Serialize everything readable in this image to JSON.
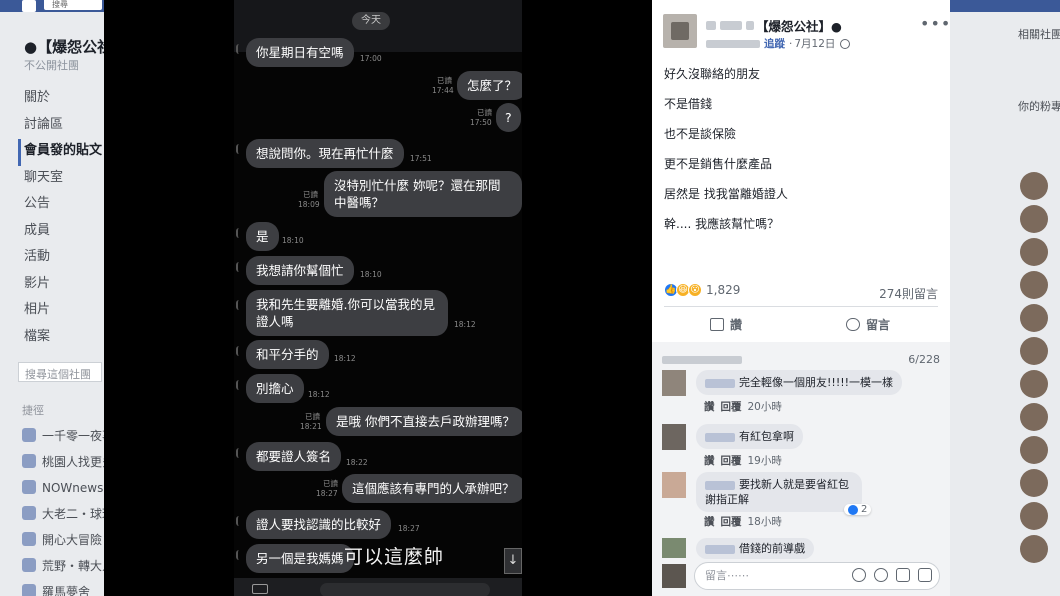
{
  "facebook": {
    "search_placeholder": "搜尋",
    "group_title": "●【爆怨公社】",
    "group_sub": "不公開社團",
    "nav": [
      "關於",
      "討論區",
      "會員發的貼文",
      "聊天室",
      "公告",
      "成員",
      "活動",
      "影片",
      "相片",
      "檔案"
    ],
    "search_group_placeholder": "搜尋這個社團",
    "shortcuts_label": "捷徑",
    "shortcuts": [
      "一千零一夜事",
      "桃園人找更多",
      "NOWnews・",
      "大老二・球球",
      "開心大冒險",
      "荒野・轉大人",
      "羅馬夢舍"
    ],
    "right_labels": [
      "相關社團",
      "你的粉專"
    ]
  },
  "chat": {
    "today": "今天",
    "subtitle": "可以這麼帥",
    "scroll_down_glyph": "↓",
    "messages": [
      {
        "dir": "in",
        "text": "你星期日有空嗎",
        "time": "17:00"
      },
      {
        "dir": "out",
        "text": "怎麼了？",
        "read": "已讀",
        "time": "17:44"
      },
      {
        "dir": "out",
        "text": "?",
        "read": "已讀",
        "time": "17:50"
      },
      {
        "dir": "in",
        "text": "想說問你。現在再忙什麼",
        "time": "17:51"
      },
      {
        "dir": "out",
        "text": "沒特別忙什麼 妳呢？還在那間中醫嗎？",
        "read": "已讀",
        "time": "18:09"
      },
      {
        "dir": "in",
        "text": "是",
        "time": "18:10"
      },
      {
        "dir": "in",
        "text": "我想請你幫個忙",
        "time": "18:10"
      },
      {
        "dir": "in",
        "text": "我和先生要離婚.你可以當我的見證人嗎",
        "time": "18:12"
      },
      {
        "dir": "in",
        "text": "和平分手的",
        "time": "18:12"
      },
      {
        "dir": "in",
        "text": "別擔心",
        "time": "18:12"
      },
      {
        "dir": "out",
        "text": "是哦 你們不直接去戶政辦理嗎？",
        "read": "已讀",
        "time": "18:21"
      },
      {
        "dir": "in",
        "text": "都要證人簽名",
        "time": "18:22"
      },
      {
        "dir": "out",
        "text": "這個應該有專門的人承辦吧？",
        "read": "已讀",
        "time": "18:27"
      },
      {
        "dir": "in",
        "text": "證人要找認識的比較好",
        "time": "18:27"
      },
      {
        "dir": "in",
        "text": "另一個是我媽媽",
        "time": ""
      }
    ]
  },
  "post": {
    "group_name": "【爆怨公社】●",
    "follow_label": "追蹤",
    "date": "7月12日",
    "more_glyph": "•••",
    "body_lines": [
      "好久沒聯絡的朋友",
      "不是借錢",
      "也不是談保險",
      "更不是銷售什麼產品",
      "居然是 找我當離婚證人",
      "幹.... 我應該幫忙嗎？"
    ],
    "reaction_count": "1,829",
    "comment_count": "274則留言",
    "like_label": "讚",
    "comment_label": "留言",
    "comments_page": "6/228",
    "comments": [
      {
        "text": "完全輕像一個朋友!!!!!一模一樣",
        "actions": [
          "讚",
          "回覆"
        ],
        "time": "20小時"
      },
      {
        "text": "有紅包拿啊",
        "actions": [
          "讚",
          "回覆"
        ],
        "time": "19小時"
      },
      {
        "text": "要找新人就是要省紅包 謝指正解",
        "actions": [
          "讚",
          "回覆"
        ],
        "time": "18小時",
        "likes": "2"
      },
      {
        "text": "借錢的前導戲",
        "actions": [],
        "time": ""
      }
    ],
    "write_placeholder": "留言⋯⋯"
  },
  "colors": {
    "facebook_blue": "#3b5998",
    "bubble": "#3d3e42",
    "like_blue": "#2078f4"
  }
}
